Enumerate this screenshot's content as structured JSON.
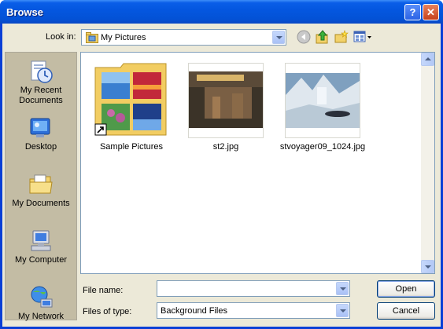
{
  "window": {
    "title": "Browse"
  },
  "titlebar": {
    "help_label": "?",
    "close_label": "✕"
  },
  "look_in": {
    "label": "Look in:",
    "value": "My Pictures"
  },
  "toolbar": {
    "icons": [
      "back-icon",
      "up-folder-icon",
      "new-folder-icon",
      "views-menu-icon"
    ]
  },
  "places": [
    {
      "label": "My Recent Documents",
      "icon": "recent-documents-icon"
    },
    {
      "label": "Desktop",
      "icon": "desktop-icon"
    },
    {
      "label": "My Documents",
      "icon": "my-documents-icon"
    },
    {
      "label": "My Computer",
      "icon": "my-computer-icon"
    },
    {
      "label": "My Network",
      "icon": "my-network-icon"
    }
  ],
  "files": [
    {
      "name": "Sample Pictures",
      "kind": "folder-shortcut"
    },
    {
      "name": "st2.jpg",
      "kind": "image"
    },
    {
      "name": "stvoyager09_1024.jpg",
      "kind": "image"
    }
  ],
  "file_name": {
    "label": "File name:",
    "value": ""
  },
  "file_type": {
    "label": "Files of type:",
    "value": "Background Files"
  },
  "buttons": {
    "open": "Open",
    "cancel": "Cancel"
  },
  "colors": {
    "title_blue": "#0457e0",
    "dialog_face": "#ece9d8",
    "close_red": "#c6411c",
    "places_bar": "#c3bca4"
  }
}
